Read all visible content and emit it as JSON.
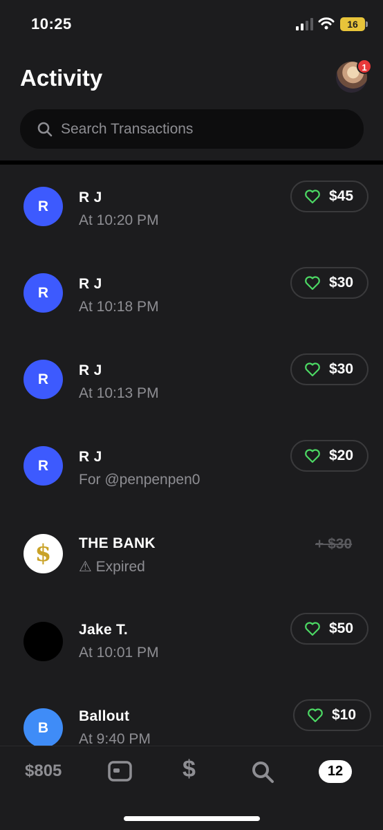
{
  "status_bar": {
    "time": "10:25",
    "battery": "16"
  },
  "header": {
    "title": "Activity",
    "notification_count": "1",
    "search": {
      "placeholder": "Search Transactions",
      "value": ""
    }
  },
  "transactions": [
    {
      "initial": "R",
      "name": "R J",
      "subtitle": "At 10:20 PM",
      "amount": "$45",
      "avatar_color": "#3d5afe"
    },
    {
      "initial": "R",
      "name": "R J",
      "subtitle": "At 10:18 PM",
      "amount": "$30",
      "avatar_color": "#3d5afe"
    },
    {
      "initial": "R",
      "name": "R J",
      "subtitle": "At 10:13 PM",
      "amount": "$30",
      "avatar_color": "#3d5afe"
    },
    {
      "initial": "R",
      "name": "R J",
      "subtitle": "For @penpenpen0",
      "amount": "$20",
      "avatar_color": "#3d5afe"
    },
    {
      "initial": "$",
      "name": "THE BANK",
      "subtitle": "⚠ Expired",
      "amount": "+ $30",
      "avatar_color": "#ffffff",
      "status": "expired"
    },
    {
      "initial": "",
      "name": "Jake T.",
      "subtitle": "At 10:01 PM",
      "amount": "$50",
      "avatar_color": "#000000"
    },
    {
      "initial": "B",
      "name": "Ballout",
      "subtitle": "At 9:40 PM",
      "amount": "$10",
      "avatar_color": "#3f8cf7"
    }
  ],
  "tab_bar": {
    "balance": "$805",
    "dollar": "$",
    "activity_count": "12"
  },
  "colors": {
    "background": "#1c1c1e",
    "heart_green": "#4cd964",
    "badge_red": "#e8393a",
    "avatar_blue": "#3d5afe"
  }
}
